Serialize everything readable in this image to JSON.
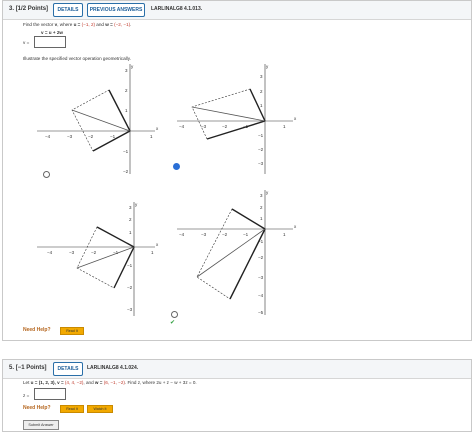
{
  "q3": {
    "number": "3.",
    "points": "[1/2 Points]",
    "details": "DETAILS",
    "previous": "PREVIOUS ANSWERS",
    "code": "LARLINALG8 4.1.013.",
    "instruction_pre": "Find the vector ",
    "instruction_v": "v",
    "instruction_mid": ", where ",
    "instruction_u": "u = ",
    "u_value": "(−1, 2)",
    "instruction_and": " and ",
    "instruction_w": "w = ",
    "w_value": "(−2, −1)",
    "equation": "v = u + 2w",
    "v_label": "v =",
    "v_value": "",
    "illustrate": "Illustrate the specified vector operation geometrically.",
    "graphs": [
      {
        "ytop": "3",
        "y2": "2",
        "y1": "1",
        "ym1": "−1",
        "ym2": "−2",
        "ym3": "−3",
        "xm4": "−4",
        "xm3": "−3",
        "xm2": "−2",
        "xm1": "−1",
        "x1": "1",
        "xl": "x",
        "yl": "y"
      },
      {
        "ytop": "3",
        "y2": "2",
        "y1": "1",
        "ym1": "−1",
        "ym2": "−2",
        "ym3": "−3",
        "xm4": "−4",
        "xm3": "−3",
        "xm2": "−2",
        "xm1": "−1",
        "x1": "1",
        "xl": "x",
        "yl": "y"
      },
      {
        "ytop": "3",
        "y2": "2",
        "y1": "1",
        "ym1": "−1",
        "ym2": "−2",
        "ym3": "−3",
        "xm4": "−4",
        "xm3": "−3",
        "xm2": "−2",
        "xm1": "−1",
        "x1": "1",
        "xl": "x",
        "yl": "y"
      },
      {
        "ytop": "3",
        "y2": "2",
        "y1": "1",
        "ym1": "−1",
        "ym2": "−2",
        "ym3": "−3",
        "ym4": "−4",
        "ym5": "−5",
        "xm4": "−4",
        "xm3": "−3",
        "xm2": "−2",
        "xm1": "−1",
        "x1": "1",
        "xl": "x",
        "yl": "y"
      }
    ],
    "need_help": "Need Help?",
    "read_it": "Read It"
  },
  "q5": {
    "number": "5.",
    "points": "[−1 Points]",
    "details": "DETAILS",
    "code": "LARLINALG8 4.1.024.",
    "let": "Let ",
    "u": "u = (1, 2, 3), ",
    "v_pre": "v = ",
    "v_val": "(4, 4, −2)",
    "and": ", and ",
    "w_pre": "w = ",
    "w_val": "(6, −1, −2)",
    "find": ". Find z, where 2u + z − w + 3z = 0.",
    "z_label": "z =",
    "z_value": "",
    "need_help": "Need Help?",
    "read_it": "Read It",
    "watch_it": "Watch It",
    "submit": "Submit Answer"
  },
  "colors": {
    "accent": "#1d5e99",
    "red": "#c0392b",
    "help": "#b5651d",
    "button": "#f2a900"
  }
}
